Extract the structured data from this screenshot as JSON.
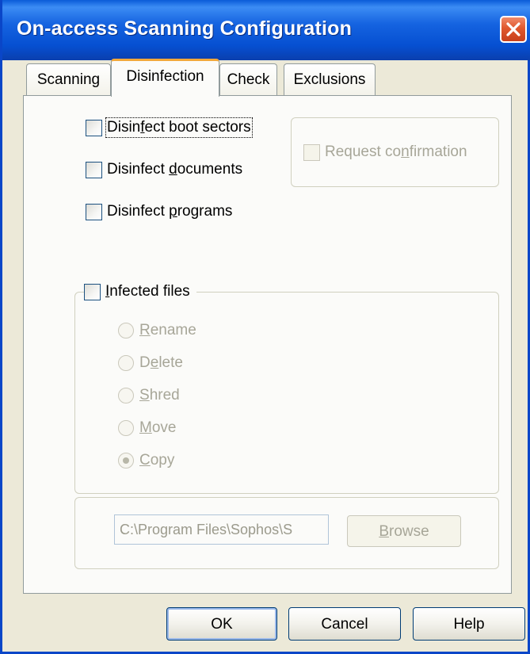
{
  "window": {
    "title": "On-access Scanning Configuration"
  },
  "tabs": [
    {
      "label": "Scanning",
      "active": false
    },
    {
      "label": "Disinfection",
      "active": true
    },
    {
      "label": "Check",
      "active": false
    },
    {
      "label": "Exclusions",
      "active": false
    }
  ],
  "disinfect": {
    "boot_sectors": {
      "pre": "Disin",
      "key": "f",
      "post": "ect boot sectors",
      "checked": false
    },
    "documents": {
      "pre": "Disinfect ",
      "key": "d",
      "post": "ocuments",
      "checked": false
    },
    "programs": {
      "pre": "Disinfect ",
      "key": "p",
      "post": "rograms",
      "checked": false
    },
    "request_confirmation": {
      "pre": "Request co",
      "key": "n",
      "post": "firmation",
      "checked": false,
      "enabled": false
    }
  },
  "infected_files": {
    "label_key": "I",
    "label_rest": "nfected files",
    "checked": false,
    "options": [
      {
        "key": "R",
        "rest": "ename",
        "pre": "",
        "checked": false
      },
      {
        "pre": "D",
        "key": "e",
        "rest": "lete",
        "checked": false
      },
      {
        "key": "S",
        "rest": "hred",
        "pre": "",
        "checked": false
      },
      {
        "key": "M",
        "rest": "ove",
        "pre": "",
        "checked": false
      },
      {
        "key": "C",
        "rest": "opy",
        "pre": "",
        "checked": true
      }
    ],
    "path_value": "C:\\Program Files\\Sophos\\S",
    "browse_key": "B",
    "browse_rest": "rowse"
  },
  "buttons": {
    "ok": "OK",
    "cancel": "Cancel",
    "help": "Help"
  },
  "colors": {
    "titlebar": "#0a5bd8",
    "close": "#e0582e",
    "active_tab_accent": "#f2a83a",
    "face": "#ece9d8"
  }
}
